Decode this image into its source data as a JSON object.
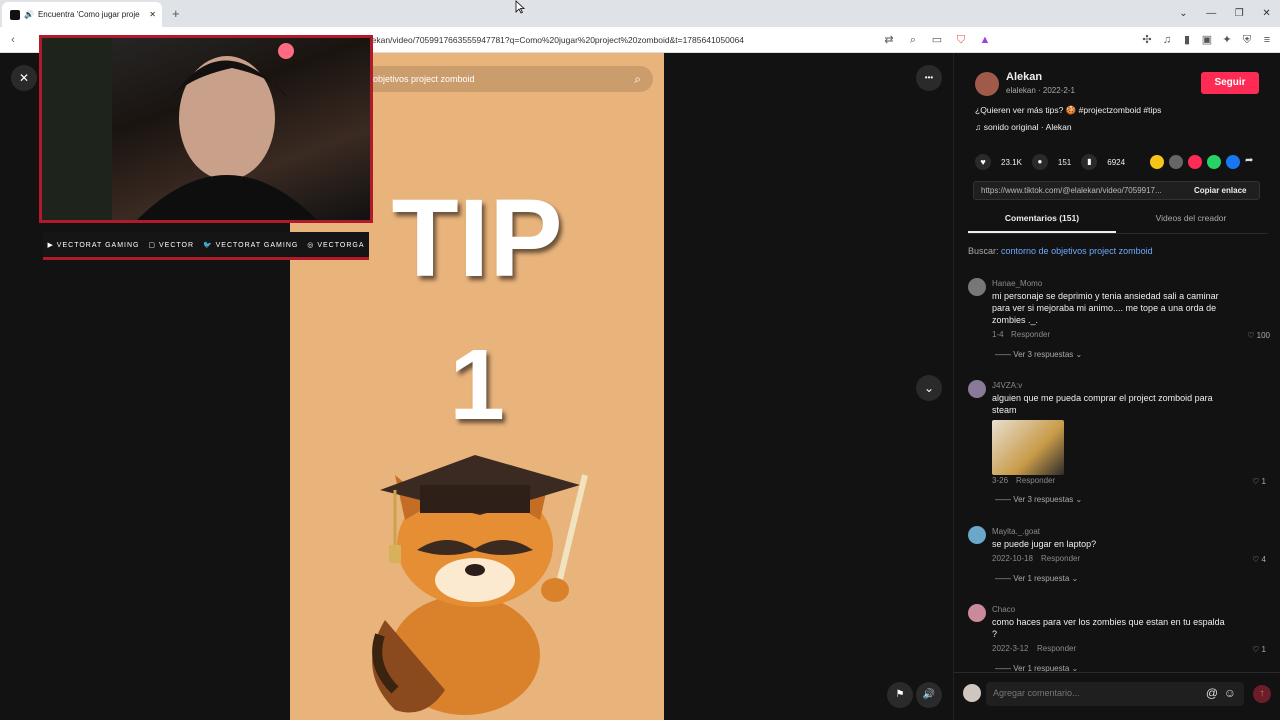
{
  "browser": {
    "tab_title": "Encuentra 'Como jugar proje",
    "tab_close": "✕",
    "new_tab": "+",
    "url": "elekan/video/7059917663555947781?q=Como%20jugar%20project%20zomboid&t=1785641050064",
    "window_controls": [
      "⌄",
      "—",
      "❐",
      "✕"
    ]
  },
  "webcam_overlay": {
    "social": [
      "VECTORAT GAMING",
      "VECTOR",
      "VECTORAT GAMING",
      "VECTORGA"
    ]
  },
  "video": {
    "search_text": "objetivos project zomboid",
    "tip_word": "TIP",
    "tip_number": "1",
    "close_label": "✕",
    "more_label": "•••",
    "down_label": "⌄"
  },
  "author": {
    "name": "Alekan",
    "meta": "elalekan · 2022-2-1",
    "follow_label": "Seguir",
    "description": "¿Quieren ver más tips? 🍪 #projectzomboid #tips",
    "sound": "sonido original · Alekan"
  },
  "stats": {
    "likes": "23.1K",
    "comments": "151",
    "saves": "6924"
  },
  "share_colors": [
    "#f5c518",
    "#666666",
    "#fe2c55",
    "#25d366",
    "#1877f2"
  ],
  "link": {
    "url": "https://www.tiktok.com/@elalekan/video/7059917...",
    "copy_label": "Copiar enlace"
  },
  "tabs": {
    "comments": "Comentarios (151)",
    "creator": "Videos del creador"
  },
  "related_search": {
    "prefix": "Buscar:",
    "query": "contorno de objetivos project zomboid"
  },
  "comments": [
    {
      "user": "Hanae_Momo",
      "text": "mi personaje se deprimio y tenia ansiedad sali a caminar para ver si mejoraba mi animo.... me tope a una orda de zombies ._.",
      "date": "1-4",
      "reply": "Responder",
      "likes": "100",
      "replies": "Ver 3 respuestas"
    },
    {
      "user": "J4VZA:v",
      "text": "alguien que me pueda comprar el project zomboid para steam",
      "date": "3-26",
      "reply": "Responder",
      "likes": "1",
      "replies": "Ver 3 respuestas"
    },
    {
      "user": "Maylta._.goat",
      "text": "se puede jugar en laptop?",
      "date": "2022-10-18",
      "reply": "Responder",
      "likes": "4",
      "replies": "Ver 1 respuesta"
    },
    {
      "user": "Chaco",
      "text": "como haces para ver los zombies que estan en tu espalda ?",
      "date": "2022-3-12",
      "reply": "Responder",
      "likes": "1",
      "replies": "Ver 1 respuesta"
    }
  ],
  "composer": {
    "placeholder": "Agregar comentario..."
  }
}
